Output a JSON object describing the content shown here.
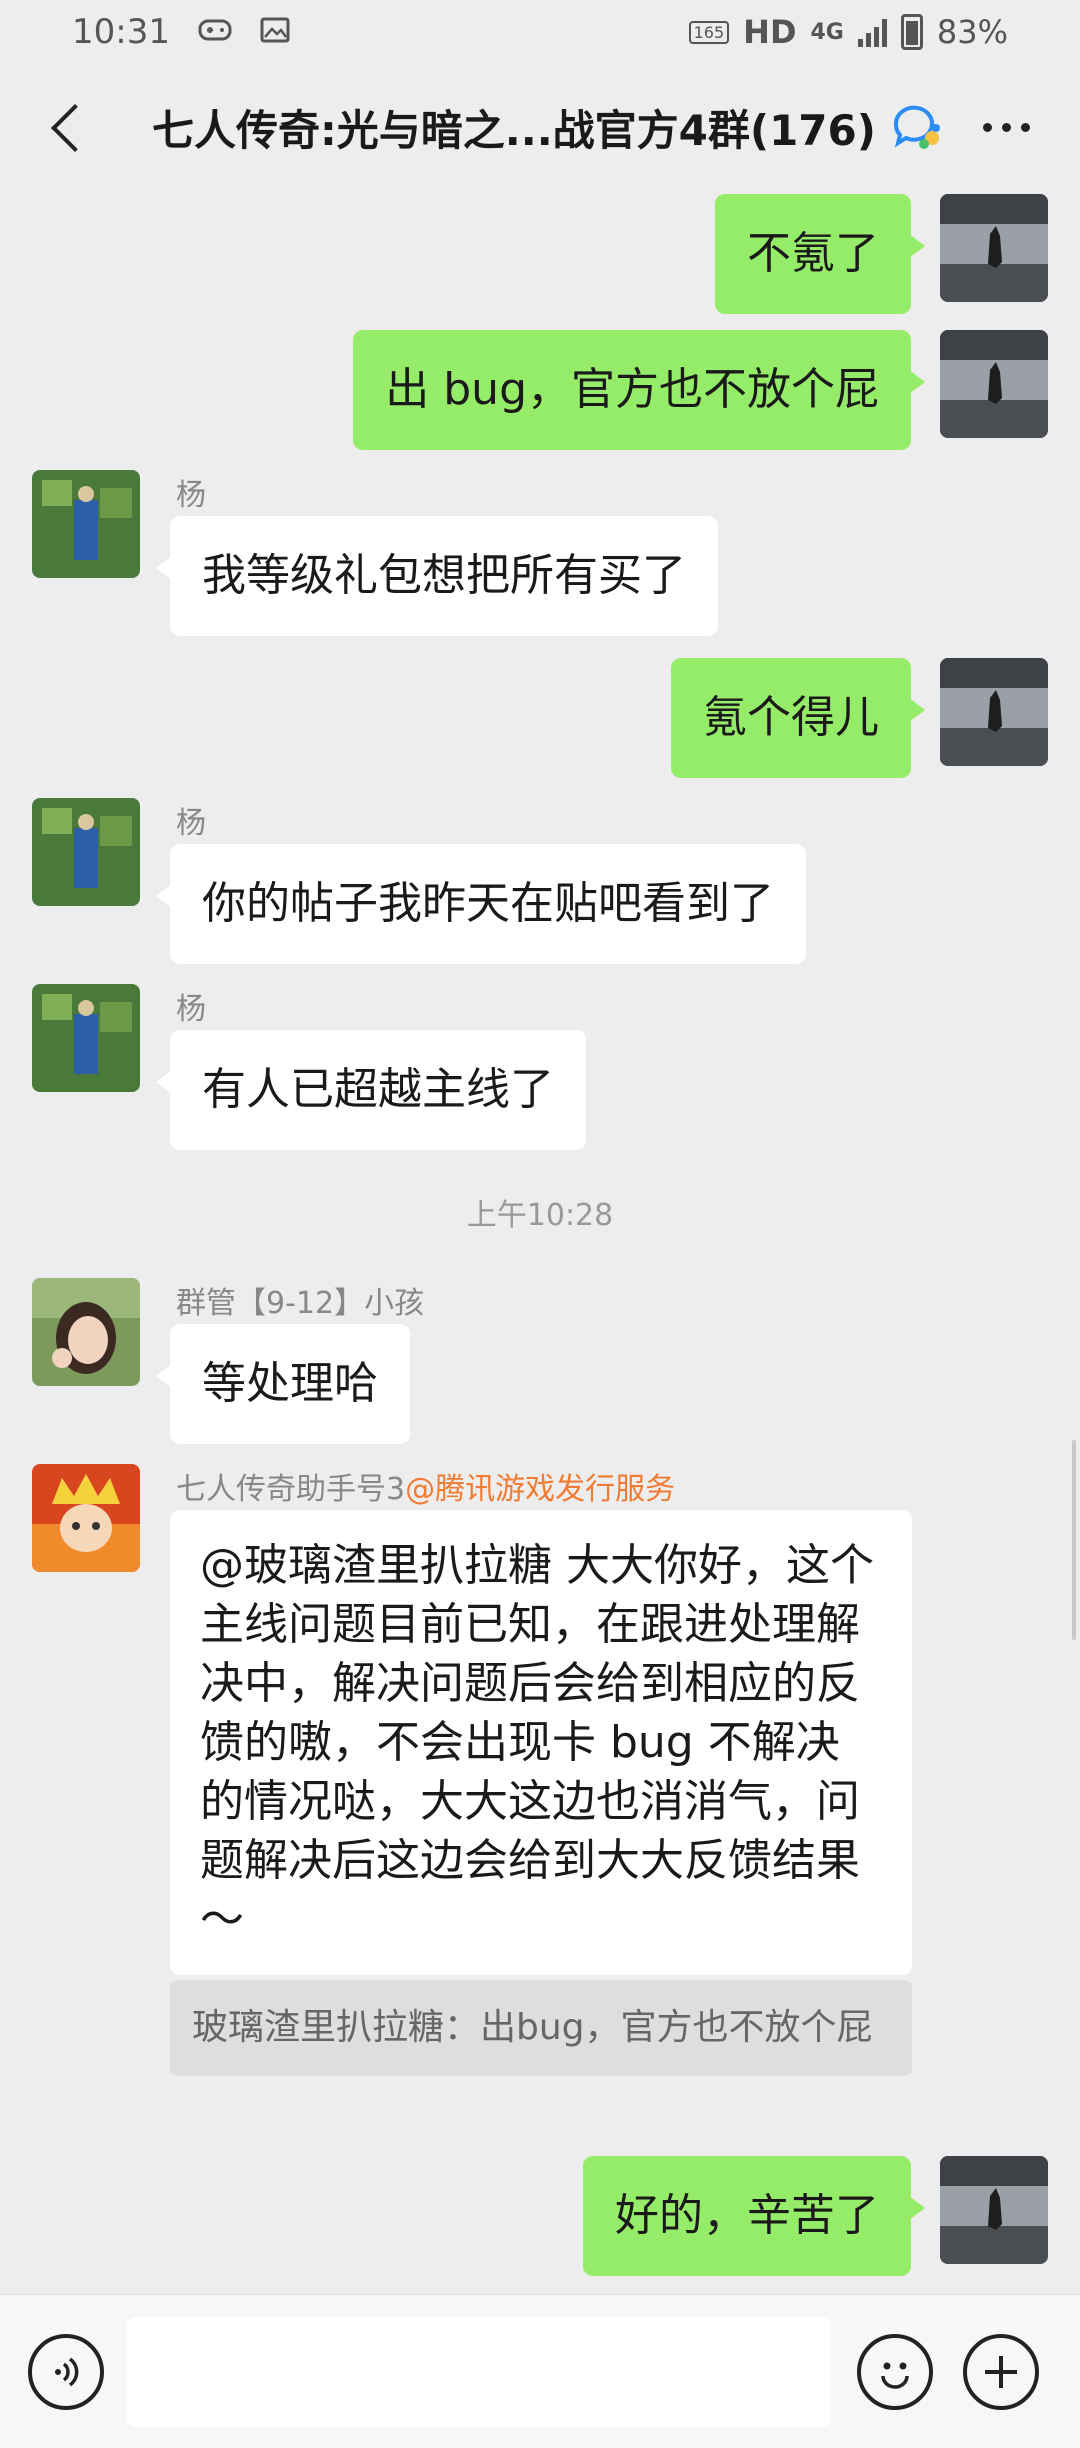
{
  "status_bar": {
    "time": "10:31",
    "refresh_rate": "165",
    "network_hd": "HD",
    "network_4g": "4G",
    "battery": "83%"
  },
  "header": {
    "title": "七人传奇:光与暗之...战官方4群(176)"
  },
  "messages": [
    {
      "side": "right",
      "text": "不氪了"
    },
    {
      "side": "right",
      "text": "出 bug，官方也不放个屁"
    },
    {
      "side": "left",
      "sender": "杨",
      "text": "我等级礼包想把所有买了"
    },
    {
      "side": "right",
      "text": "氪个得儿"
    },
    {
      "side": "left",
      "sender": "杨",
      "text": "你的帖子我昨天在贴吧看到了"
    },
    {
      "side": "left",
      "sender": "杨",
      "text": "有人已超越主线了"
    },
    {
      "side": "left",
      "sender": "群管【9-12】小孩",
      "text": "等处理哈"
    },
    {
      "side": "left",
      "sender": "七人传奇助手号3",
      "sender_tag": "@腾讯游戏发行服务",
      "text": "@玻璃渣里扒拉糖  大大你好，这个主线问题目前已知，在跟进处理解决中，解决问题后会给到相应的反馈的嗷，不会出现卡 bug 不解决的情况哒，大大这边也消消气，问题解决后这边会给到大大反馈结果～",
      "quote": "玻璃渣里扒拉糖：出bug，官方也不放个屁"
    },
    {
      "side": "right",
      "text": "好的，辛苦了"
    }
  ],
  "timestamp": "上午10:28",
  "colors": {
    "bubble_self": "#95ec69",
    "bubble_other": "#ffffff",
    "background": "#ededed",
    "mention_tag": "#f07c33"
  }
}
